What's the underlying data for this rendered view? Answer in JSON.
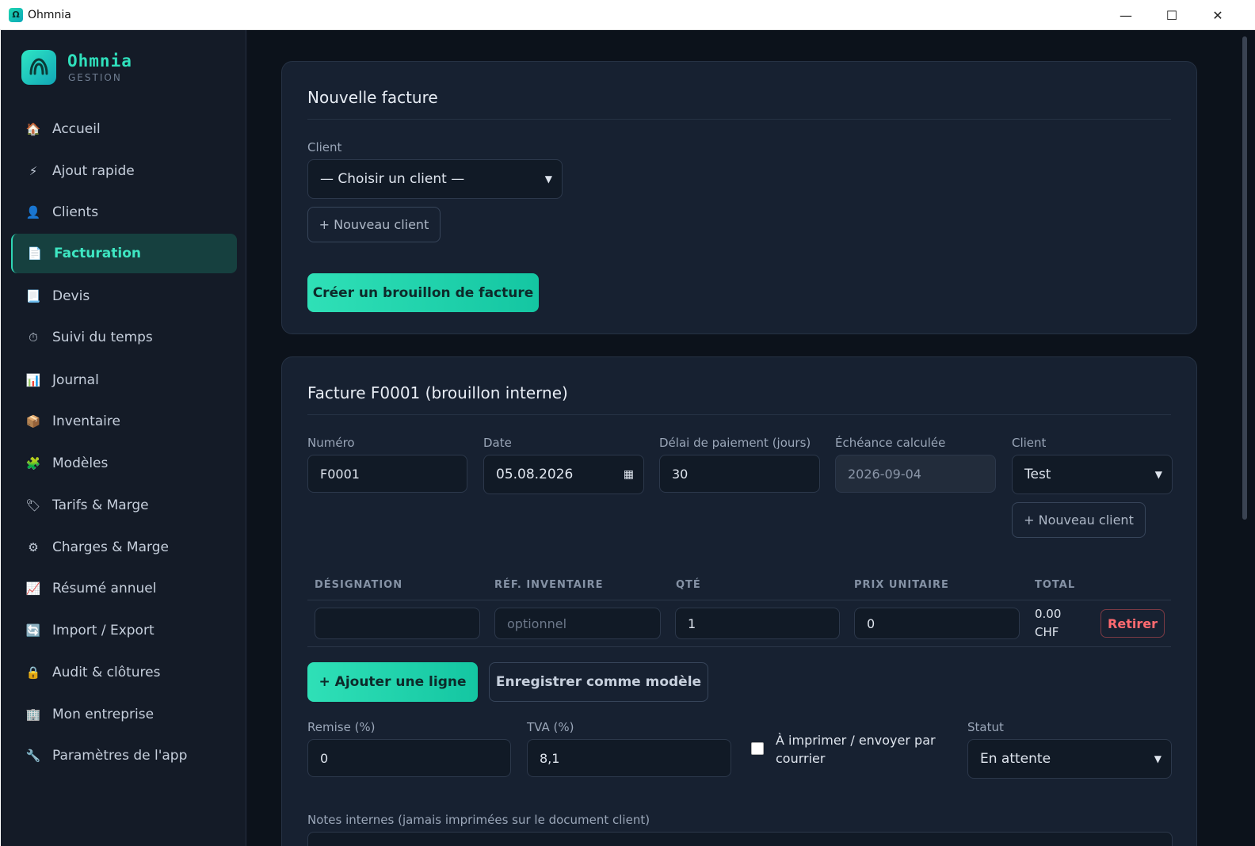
{
  "window": {
    "title": "Ohmnia"
  },
  "brand": {
    "name": "Ohmnia",
    "subtitle": "GESTION"
  },
  "sidebar": {
    "items": [
      {
        "label": "Accueil",
        "icon": "🏠"
      },
      {
        "label": "Ajout rapide",
        "icon": "⚡"
      },
      {
        "label": "Clients",
        "icon": "👤"
      },
      {
        "label": "Facturation",
        "icon": "📄",
        "active": true
      },
      {
        "label": "Devis",
        "icon": "📃"
      },
      {
        "label": "Suivi du temps",
        "icon": "⏱"
      },
      {
        "label": "Journal",
        "icon": "📊"
      },
      {
        "label": "Inventaire",
        "icon": "📦"
      },
      {
        "label": "Modèles",
        "icon": "🧩"
      },
      {
        "label": "Tarifs & Marge",
        "icon": "🏷"
      },
      {
        "label": "Charges & Marge",
        "icon": "⚙"
      },
      {
        "label": "Résumé annuel",
        "icon": "📈"
      },
      {
        "label": "Import / Export",
        "icon": "🔄"
      },
      {
        "label": "Audit & clôtures",
        "icon": "🔒"
      },
      {
        "label": "Mon entreprise",
        "icon": "🏢"
      },
      {
        "label": "Paramètres de l'app",
        "icon": "🔧"
      }
    ]
  },
  "new_invoice": {
    "title": "Nouvelle facture",
    "client_label": "Client",
    "client_select": "— Choisir un client —",
    "new_client_button": "+ Nouveau client",
    "create_draft_button": "Créer un brouillon de facture"
  },
  "invoice": {
    "title": "Facture F0001 (brouillon interne)",
    "number_label": "Numéro",
    "number_value": "F0001",
    "date_label": "Date",
    "date_value": "05.08.2026",
    "payment_delay_label": "Délai de paiement (jours)",
    "payment_delay_value": "30",
    "due_label": "Échéance calculée",
    "due_value": "2026-09-04",
    "client_label": "Client",
    "client_value": "Test",
    "new_client_button": "+ Nouveau client",
    "columns": [
      "DÉSIGNATION",
      "RÉF. INVENTAIRE",
      "QTÉ",
      "PRIX UNITAIRE",
      "TOTAL"
    ],
    "line": {
      "designation": "",
      "ref_placeholder": "optionnel",
      "qty": "1",
      "unit_price": "0",
      "total_amount": "0.00",
      "total_currency": "CHF",
      "remove_button": "Retirer"
    },
    "add_line_button": "+ Ajouter une ligne",
    "save_template_button": "Enregistrer comme modèle",
    "discount_label": "Remise (%)",
    "discount_value": "0",
    "vat_label": "TVA (%)",
    "vat_value": "8,1",
    "mail_checkbox_label": "À imprimer / envoyer par courrier",
    "status_label": "Statut",
    "status_value": "En attente",
    "notes_label": "Notes internes (jamais imprimées sur le document client)"
  }
}
